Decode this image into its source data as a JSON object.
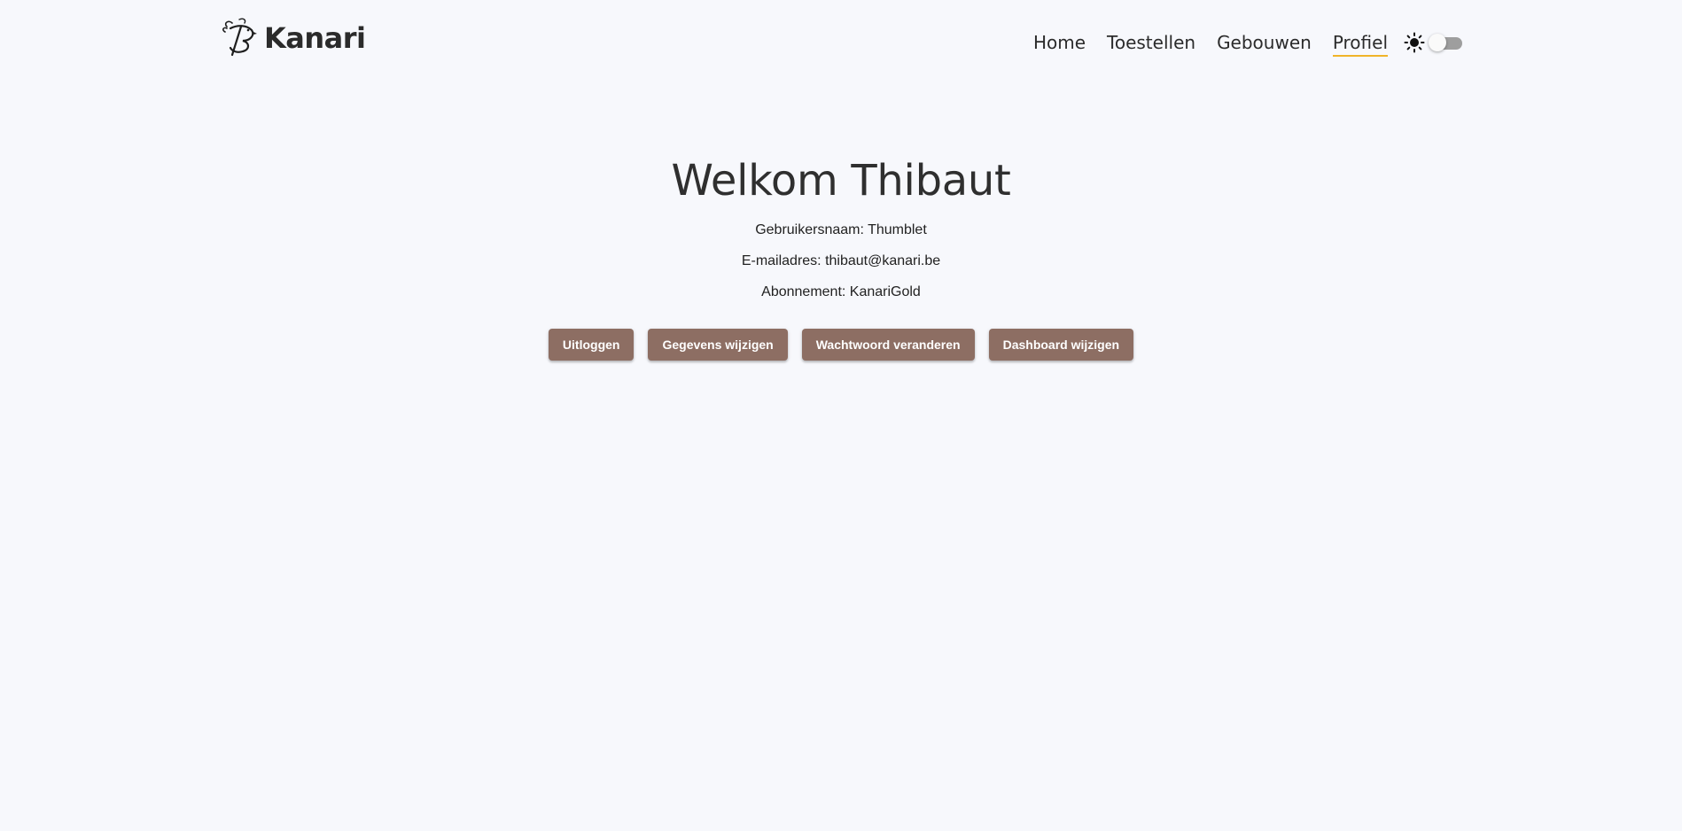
{
  "header": {
    "brand_name": "Kanari",
    "logo_icon": "bird-logo-icon",
    "nav": [
      {
        "label": "Home",
        "active": false
      },
      {
        "label": "Toestellen",
        "active": false
      },
      {
        "label": "Gebouwen",
        "active": false
      },
      {
        "label": "Profiel",
        "active": true
      }
    ],
    "theme_icon": "sun-icon",
    "theme_toggle_on": false,
    "active_underline_color": "#f0b429"
  },
  "profile": {
    "title": "Welkom Thibaut",
    "username_line": "Gebruikersnaam: Thumblet",
    "email_line": "E-mailadres: thibaut@kanari.be",
    "subscription_line": "Abonnement: KanariGold"
  },
  "actions": {
    "logout": "Uitloggen",
    "edit_details": "Gegevens wijzigen",
    "change_password": "Wachtwoord veranderen",
    "edit_dashboard": "Dashboard wijzigen",
    "button_color": "#8d6e63"
  }
}
